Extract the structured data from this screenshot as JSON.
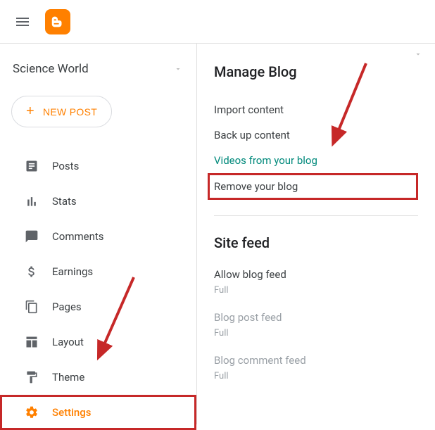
{
  "header": {
    "blog_name": "Science World",
    "new_post_label": "NEW POST"
  },
  "sidebar": {
    "items": [
      {
        "label": "Posts",
        "icon": "posts-icon"
      },
      {
        "label": "Stats",
        "icon": "stats-icon"
      },
      {
        "label": "Comments",
        "icon": "comments-icon"
      },
      {
        "label": "Earnings",
        "icon": "earnings-icon"
      },
      {
        "label": "Pages",
        "icon": "pages-icon"
      },
      {
        "label": "Layout",
        "icon": "layout-icon"
      },
      {
        "label": "Theme",
        "icon": "theme-icon"
      },
      {
        "label": "Settings",
        "icon": "settings-icon"
      }
    ]
  },
  "main": {
    "manage_title": "Manage Blog",
    "manage_options": {
      "import": "Import content",
      "backup": "Back up content",
      "videos": "Videos from your blog",
      "remove": "Remove your blog"
    },
    "feed_title": "Site feed",
    "feed_items": [
      {
        "label": "Allow blog feed",
        "value": "Full"
      },
      {
        "label": "Blog post feed",
        "value": "Full"
      },
      {
        "label": "Blog comment feed",
        "value": "Full"
      }
    ]
  }
}
